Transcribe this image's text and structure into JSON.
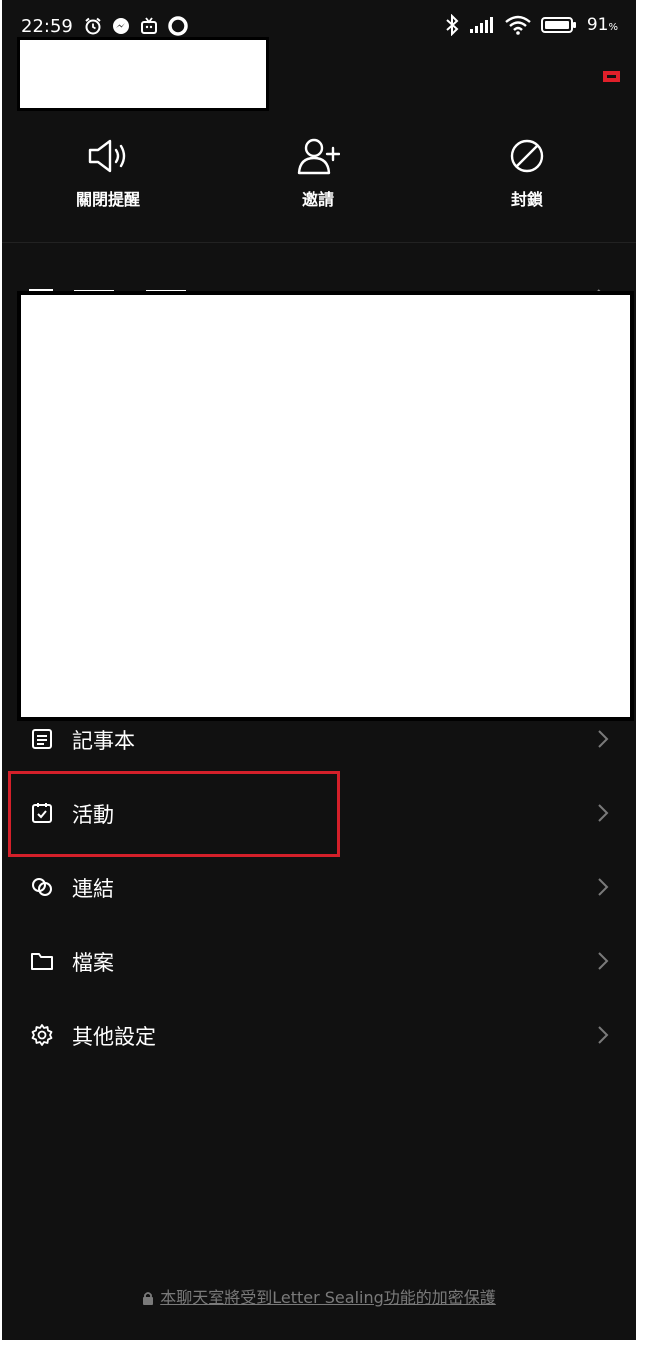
{
  "status_bar": {
    "time": "22:59",
    "battery_percent": "91",
    "battery_unit": "%",
    "left_icons": [
      "alarm-icon",
      "messenger-icon",
      "tv-app-icon",
      "circle-app-icon"
    ],
    "right_icons": [
      "bluetooth-icon",
      "signal-icon",
      "wifi-icon",
      "battery-icon"
    ]
  },
  "actions": [
    {
      "label": "關閉提醒",
      "icon": "speaker-icon"
    },
    {
      "label": "邀請",
      "icon": "add-user-icon"
    },
    {
      "label": "封鎖",
      "icon": "block-icon"
    }
  ],
  "menu": {
    "items": [
      {
        "label": "記事本",
        "icon": "note-icon"
      },
      {
        "label": "活動",
        "icon": "calendar-check-icon"
      },
      {
        "label": "連結",
        "icon": "link-icon"
      },
      {
        "label": "檔案",
        "icon": "folder-icon"
      },
      {
        "label": "其他設定",
        "icon": "gear-icon"
      }
    ]
  },
  "footer": {
    "text": "本聊天室將受到Letter Sealing功能的加密保護",
    "icon": "lock-icon"
  },
  "colors": {
    "background": "#111111",
    "text": "#ffffff",
    "highlight": "#d4202a",
    "muted": "#7a7a7a"
  }
}
